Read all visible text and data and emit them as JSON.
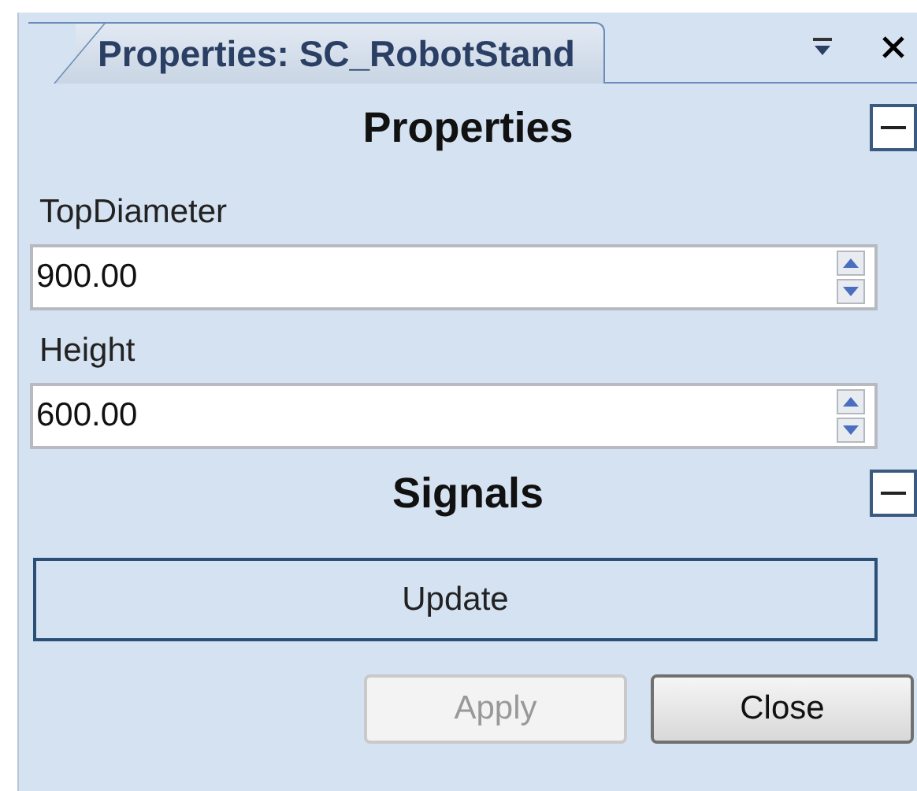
{
  "tab": {
    "title": "Properties: SC_RobotStand"
  },
  "sections": [
    {
      "title": "Properties",
      "expanded": true,
      "fields": [
        {
          "label": "TopDiameter",
          "value": "900.00"
        },
        {
          "label": "Height",
          "value": "600.00"
        }
      ]
    },
    {
      "title": "Signals",
      "expanded": true,
      "signals": [
        "Update"
      ]
    }
  ],
  "buttons": [
    {
      "label": "Apply",
      "disabled": true
    },
    {
      "label": "Close",
      "disabled": false
    }
  ]
}
